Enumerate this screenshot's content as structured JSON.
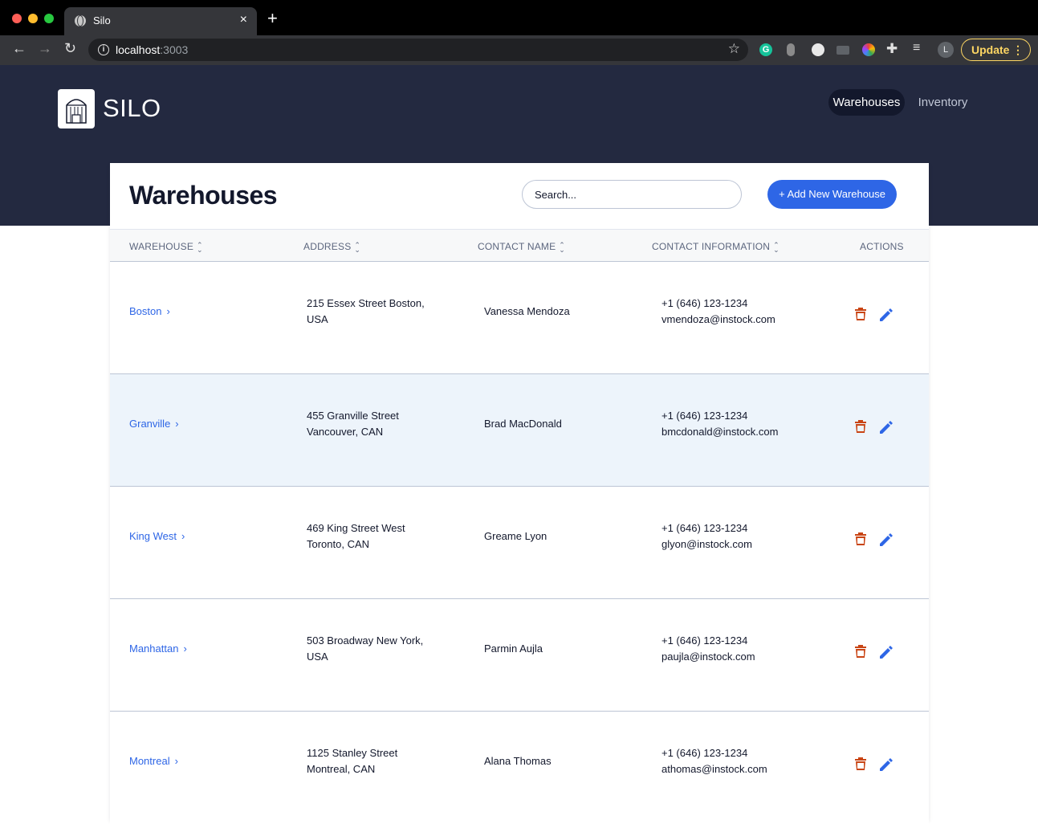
{
  "browser": {
    "tab_title": "Silo",
    "tab_close": "×",
    "new_tab": "+",
    "url_host": "localhost",
    "url_port": ":3003",
    "profile_initial": "L",
    "update_label": "Update",
    "extensions": [
      "grammarly-icon",
      "extension-icon",
      "extension-icon",
      "camera-icon",
      "color-picker-icon",
      "puzzle-icon",
      "queue-icon"
    ]
  },
  "header": {
    "logo_text": "SILO",
    "nav": [
      {
        "label": "Warehouses",
        "active": true
      },
      {
        "label": "Inventory",
        "active": false
      }
    ]
  },
  "page": {
    "title": "Warehouses",
    "search_placeholder": "Search...",
    "add_button": "+ Add New Warehouse"
  },
  "table": {
    "columns": [
      "WAREHOUSE",
      "ADDRESS",
      "CONTACT NAME",
      "CONTACT INFORMATION",
      "ACTIONS"
    ],
    "rows": [
      {
        "warehouse": "Boston",
        "address_1": "215 Essex Street Boston,",
        "address_2": "USA",
        "contact": "Vanessa Mendoza",
        "phone": "+1 (646) 123-1234",
        "email": "vmendoza@instock.com"
      },
      {
        "warehouse": "Granville",
        "address_1": "455 Granville Street",
        "address_2": "Vancouver, CAN",
        "contact": "Brad MacDonald",
        "phone": "+1 (646) 123-1234",
        "email": "bmcdonald@instock.com"
      },
      {
        "warehouse": "King West",
        "address_1": "469 King Street West",
        "address_2": "Toronto, CAN",
        "contact": "Greame Lyon",
        "phone": "+1 (646) 123-1234",
        "email": "glyon@instock.com"
      },
      {
        "warehouse": "Manhattan",
        "address_1": "503 Broadway New York,",
        "address_2": "USA",
        "contact": "Parmin Aujla",
        "phone": "+1 (646) 123-1234",
        "email": "paujla@instock.com"
      },
      {
        "warehouse": "Montreal",
        "address_1": "1125 Stanley Street",
        "address_2": "Montreal, CAN",
        "contact": "Alana Thomas",
        "phone": "+1 (646) 123-1234",
        "email": "athomas@instock.com"
      }
    ]
  },
  "colors": {
    "header_bg": "#232940",
    "accent": "#2e66e6",
    "delete": "#c94515",
    "text": "#13182c"
  }
}
